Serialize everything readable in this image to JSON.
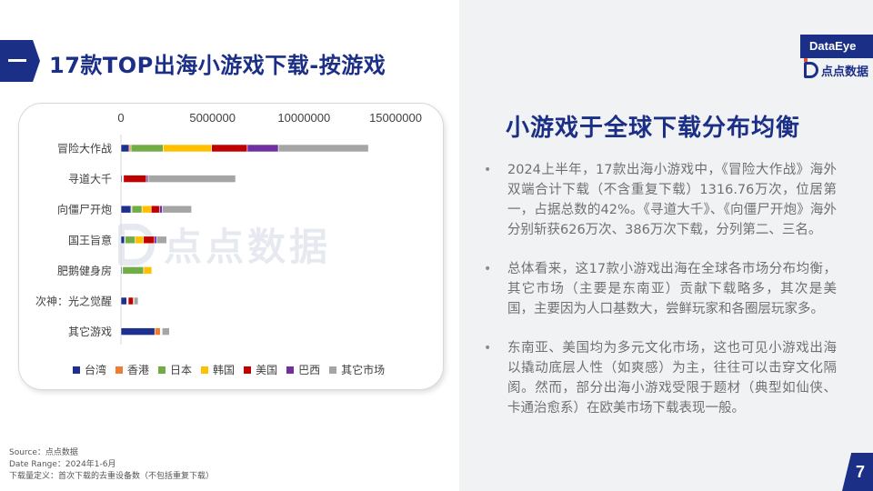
{
  "header": {
    "title": "17款TOP出海小游戏下载-按游戏"
  },
  "brand": {
    "logo_top": "DataEye",
    "logo_bottom": "点点数据",
    "watermark": "点点数据",
    "primary_color": "#1b2f86"
  },
  "chart_data": {
    "type": "bar",
    "orientation": "horizontal",
    "stacked": true,
    "categories": [
      "冒险大作战",
      "寻道大千",
      "向僵尸开炮",
      "国王旨意",
      "肥鹅健身房",
      "次神：光之觉醒",
      "其它游戏"
    ],
    "xticks": [
      "0",
      "5000000",
      "10000000",
      "15000000"
    ],
    "xlim": [
      0,
      15000000
    ],
    "axis_position": "top",
    "legend_position": "bottom",
    "grid": false,
    "series": [
      {
        "name": "台湾",
        "color": "#1d2f8f",
        "values": [
          450000,
          60000,
          550000,
          200000,
          60000,
          320000,
          1850000
        ]
      },
      {
        "name": "香港",
        "color": "#ed7d31",
        "values": [
          100000,
          20000,
          50000,
          30000,
          30000,
          30000,
          300000
        ]
      },
      {
        "name": "日本",
        "color": "#70ad47",
        "values": [
          1750000,
          30000,
          550000,
          550000,
          1150000,
          20000,
          30000
        ]
      },
      {
        "name": "韩国",
        "color": "#ffc000",
        "values": [
          2650000,
          30000,
          500000,
          450000,
          450000,
          30000,
          30000
        ]
      },
      {
        "name": "美国",
        "color": "#c00000",
        "values": [
          1950000,
          1250000,
          450000,
          600000,
          20000,
          280000,
          20000
        ]
      },
      {
        "name": "巴西",
        "color": "#7030a0",
        "values": [
          1700000,
          100000,
          150000,
          120000,
          20000,
          30000,
          20000
        ]
      },
      {
        "name": "其它市场",
        "color": "#a5a5a5",
        "values": [
          4917600,
          4770000,
          1610000,
          550000,
          20000,
          230000,
          400000
        ]
      }
    ]
  },
  "source": {
    "line1": "Source：点点数据",
    "line2": "Date Range：2024年1-6月",
    "line3": "下载量定义：首次下载的去重设备数（不包括重复下载）"
  },
  "right_panel": {
    "heading": "小游戏于全球下载分布均衡",
    "bullet_marker": "•",
    "bullets": [
      "2024上半年，17款出海小游戏中，《冒险大作战》海外双端合计下载（不含重复下载）1316.76万次，位居第一，占据总数的42%。《寻道大千》、《向僵尸开炮》海外分别斩获626万次、386万次下载，分列第二、三名。",
      "总体看来，这17款小游戏出海在全球各市场分布均衡，其它市场（主要是东南亚）贡献下载略多，其次是美国，主要因为人口基数大，尝鲜玩家和各圈层玩家多。",
      "东南亚、美国均为多元文化市场，这也可见小游戏出海以撬动底层人性（如爽感）为主，往往可以击穿文化隔阂。然而，部分出海小游戏受限于题材（典型如仙侠、卡通治愈系）在欧美市场下载表现一般。"
    ]
  },
  "page_number": "7"
}
